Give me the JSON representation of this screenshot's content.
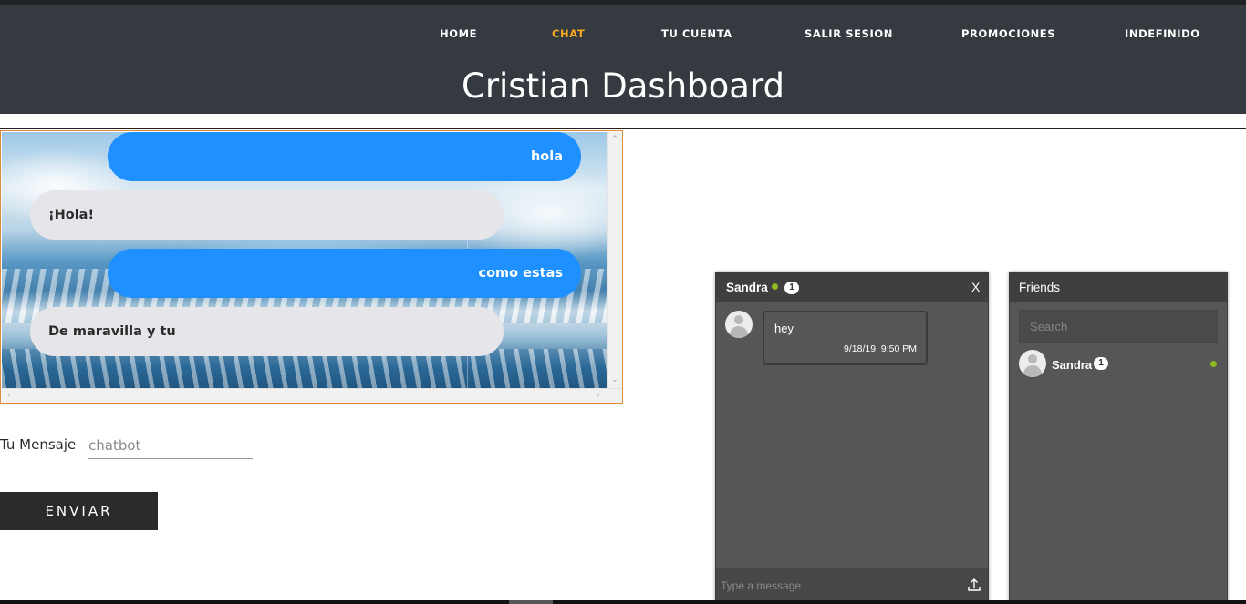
{
  "nav": {
    "items": [
      {
        "label": "HOME",
        "active": false
      },
      {
        "label": "CHAT",
        "active": true
      },
      {
        "label": "TU CUENTA",
        "active": false
      },
      {
        "label": "SALIR SESION",
        "active": false
      },
      {
        "label": "PROMOCIONES",
        "active": false
      },
      {
        "label": "INDEFINIDO",
        "active": false
      }
    ],
    "active_color": "#f5a623"
  },
  "page": {
    "title": "Cristian Dashboard"
  },
  "chat": {
    "messages": [
      {
        "sender": "user",
        "text": "hola"
      },
      {
        "sender": "bot",
        "text": "¡Hola!"
      },
      {
        "sender": "user",
        "text": "como estas"
      },
      {
        "sender": "bot",
        "text": "De maravilla y tu"
      }
    ],
    "user_bubble_color": "#1e90ff",
    "bot_bubble_color": "#e6e5ea",
    "frame_border_color": "#e08a3c"
  },
  "form": {
    "label": "Tu Mensaje",
    "input_placeholder": "chatbot",
    "input_value": "",
    "send_label": "ENVIAR"
  },
  "chat_window": {
    "contact_name": "Sandra",
    "unread_count": "1",
    "close_label": "X",
    "online_color": "#8cb820",
    "message": {
      "text": "hey",
      "time": "9/18/19, 9:50 PM"
    },
    "input_placeholder": "Type a message",
    "upload_icon": "upload-icon"
  },
  "friends": {
    "title": "Friends",
    "search_placeholder": "Search",
    "items": [
      {
        "name": "Sandra",
        "count": "1",
        "online": true
      }
    ]
  }
}
